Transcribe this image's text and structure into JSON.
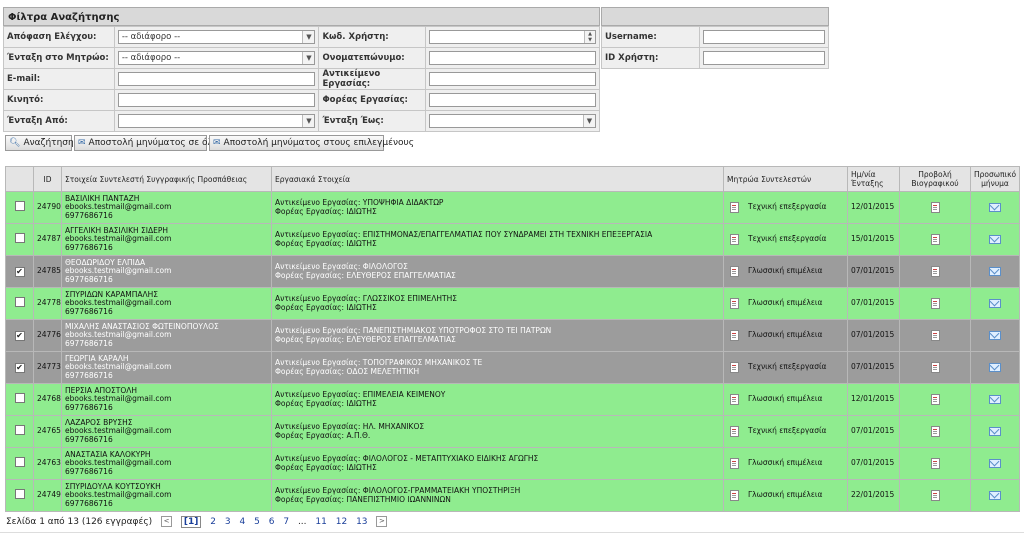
{
  "filters": {
    "title": "Φίλτρα Αναζήτησης",
    "decision_label": "Απόφαση Ελέγχου:",
    "decision_value": "-- αδιάφορο --",
    "registry_label": "Ένταξη στο Μητρώο:",
    "registry_value": "-- αδιάφορο --",
    "email_label": "E-mail:",
    "mobile_label": "Κινητό:",
    "from_label": "Ένταξη Από:",
    "usercode_label": "Κωδ. Χρήστη:",
    "fullname_label": "Ονοματεπώνυμο:",
    "work_object_label": "Αντικείμενο Εργασίας:",
    "work_body_label": "Φορέας Εργασίας:",
    "to_label": "Ένταξη Έως:",
    "username_label": "Username:",
    "userid_label": "ID Χρήστη:"
  },
  "actions": {
    "search": "Αναζήτηση",
    "send_all": "Αποστολή μηνύματος σε όλους",
    "send_selected": "Αποστολή μηνύματος στους επιλεγμένους"
  },
  "table": {
    "headers": {
      "id": "ID",
      "contributor": "Στοιχεία Συντελεστή Συγγραφικής Προσπάθειας",
      "work": "Εργασιακά Στοιχεία",
      "registry": "Μητρώα Συντελεστών",
      "date": "Ημ/νία Ένταξης",
      "cv": "Προβολή Βιογραφικού",
      "msg": "Προσωπικό μήνυμα"
    },
    "rows": [
      {
        "status": "green",
        "checked": "",
        "id": "24790",
        "name": "ΒΑΣΙΛΙΚΗ ΠΑΝΤΑΖΗ",
        "email": "ebooks.testmail@gmail.com",
        "phone": "6977686716",
        "object": "Αντικείμενο Εργασίας: ΥΠΟΨΗΦΙΑ ΔΙΔΑΚΤΩΡ",
        "body": "Φορέας Εργασίας: ΙΔΙΩΤΗΣ",
        "registry": "Τεχνική επεξεργασία",
        "date": "12/01/2015"
      },
      {
        "status": "green",
        "checked": "",
        "id": "24787",
        "name": "ΑΓΓΕΛΙΚΗ ΒΑΣΙΛΙΚΗ ΣΙΔΕΡΗ",
        "email": "ebooks.testmail@gmail.com",
        "phone": "6977686716",
        "object": "Αντικείμενο Εργασίας: ΕΠΙΣΤΗΜΟΝΑΣ/ΕΠΑΓΓΕΛΜΑΤΙΑΣ ΠΟΥ ΣΥΝΔΡΑΜΕΙ ΣΤΗ ΤΕΧΝΙΚΗ ΕΠΕΞΕΡΓΑΣΙΑ",
        "body": "Φορέας Εργασίας: ΙΔΙΩΤΗΣ",
        "registry": "Τεχνική επεξεργασία",
        "date": "15/01/2015"
      },
      {
        "status": "gray",
        "checked": "✔",
        "id": "24785",
        "name": "ΘΕΟΔΩΡΙΔΟΥ ΕΛΠΙΔΑ",
        "email": "ebooks.testmail@gmail.com",
        "phone": "6977686716",
        "object": "Αντικείμενο Εργασίας: ΦΙΛΟΛΟΓΟΣ",
        "body": "Φορέας Εργασίας: ΕΛΕΥΘΕΡΟΣ ΕΠΑΓΓΕΛΜΑΤΙΑΣ",
        "registry": "Γλωσσική επιμέλεια",
        "date": "07/01/2015"
      },
      {
        "status": "green",
        "checked": "",
        "id": "24778",
        "name": "ΣΠΥΡΙΔΩΝ ΚΑΡΑΜΠΑΛΗΣ",
        "email": "ebooks.testmail@gmail.com",
        "phone": "6977686716",
        "object": "Αντικείμενο Εργασίας: ΓΛΩΣΣΙΚΟΣ ΕΠΙΜΕΛΗΤΗΣ",
        "body": "Φορέας Εργασίας: ΙΔΙΩΤΗΣ",
        "registry": "Γλωσσική επιμέλεια",
        "date": "07/01/2015"
      },
      {
        "status": "gray",
        "checked": "✔",
        "id": "24776",
        "name": "ΜΙΧΑΛΗΣ ΑΝΑΣΤΑΣΙΟΣ ΦΩΤΕΙΝΟΠΟΥΛΟΣ",
        "email": "ebooks.testmail@gmail.com",
        "phone": "6977686716",
        "object": "Αντικείμενο Εργασίας: ΠΑΝΕΠΙΣΤΗΜΙΑΚΟΣ ΥΠΟΤΡΟΦΟΣ ΣΤΟ ΤΕΙ ΠΑΤΡΩΝ",
        "body": "Φορέας Εργασίας: ΕΛΕΥΘΕΡΟΣ ΕΠΑΓΓΕΛΜΑΤΙΑΣ",
        "registry": "Γλωσσική επιμέλεια",
        "date": "07/01/2015"
      },
      {
        "status": "gray",
        "checked": "✔",
        "id": "24773",
        "name": "ΓΕΩΡΓΙΑ ΚΑΡΑΛΗ",
        "email": "ebooks.testmail@gmail.com",
        "phone": "6977686716",
        "object": "Αντικείμενο Εργασίας: ΤΟΠΟΓΡΑΦΙΚΟΣ ΜΗΧΑΝΙΚΟΣ ΤΕ",
        "body": "Φορέας Εργασίας: ΟΔΟΣ ΜΕΛΕΤΗΤΙΚΗ",
        "registry": "Τεχνική επεξεργασία",
        "date": "07/01/2015"
      },
      {
        "status": "green",
        "checked": "",
        "id": "24768",
        "name": "ΠΕΡΣΙΑ ΑΠΟΣΤΟΛΗ",
        "email": "ebooks.testmail@gmail.com",
        "phone": "6977686716",
        "object": "Αντικείμενο Εργασίας: ΕΠΙΜΕΛΕΙΑ ΚΕΙΜΕΝΟΥ",
        "body": "Φορέας Εργασίας: ΙΔΙΩΤΗΣ",
        "registry": "Γλωσσική επιμέλεια",
        "date": "12/01/2015"
      },
      {
        "status": "green",
        "checked": "",
        "id": "24765",
        "name": "ΛΑΖΑΡΟΣ ΒΡΥΣΗΣ",
        "email": "ebooks.testmail@gmail.com",
        "phone": "6977686716",
        "object": "Αντικείμενο Εργασίας: ΗΛ. ΜΗΧΑΝΙΚΟΣ",
        "body": "Φορέας Εργασίας: Α.Π.Θ.",
        "registry": "Τεχνική επεξεργασία",
        "date": "07/01/2015"
      },
      {
        "status": "green",
        "checked": "",
        "id": "24763",
        "name": "ΑΝΑΣΤΑΣΙΑ ΚΑΛΟΚΥΡΗ",
        "email": "ebooks.testmail@gmail.com",
        "phone": "6977686716",
        "object": "Αντικείμενο Εργασίας: ΦΙΛΟΛΟΓΟΣ - ΜΕΤΑΠΤΥΧΙΑΚΟ ΕΙΔΙΚΗΣ ΑΓΩΓΗΣ",
        "body": "Φορέας Εργασίας: ΙΔΙΩΤΗΣ",
        "registry": "Γλωσσική επιμέλεια",
        "date": "07/01/2015"
      },
      {
        "status": "green",
        "checked": "",
        "id": "24749",
        "name": "ΣΠΥΡΙΔΟΥΛΑ ΚΟΥΤΣΟΥΚΗ",
        "email": "ebooks.testmail@gmail.com",
        "phone": "6977686716",
        "object": "Αντικείμενο Εργασίας: ΦΙΛΟΛΟΓΟΣ-ΓΡΑΜΜΑΤΕΙΑΚΗ ΥΠΟΣΤΗΡΙΞΗ",
        "body": "Φορέας Εργασίας: ΠΑΝΕΠΙΣΤΗΜΙΟ ΙΩΑΝΝΙΝΩΝ",
        "registry": "Γλωσσική επιμέλεια",
        "date": "22/01/2015"
      }
    ]
  },
  "pager": {
    "summary": "Σελίδα 1 από 13 (126 εγγραφές)",
    "prev": "<",
    "next": ">",
    "ellipsis": "...",
    "pages": [
      "[1]",
      "2",
      "3",
      "4",
      "5",
      "6",
      "7",
      "11",
      "12",
      "13"
    ]
  }
}
